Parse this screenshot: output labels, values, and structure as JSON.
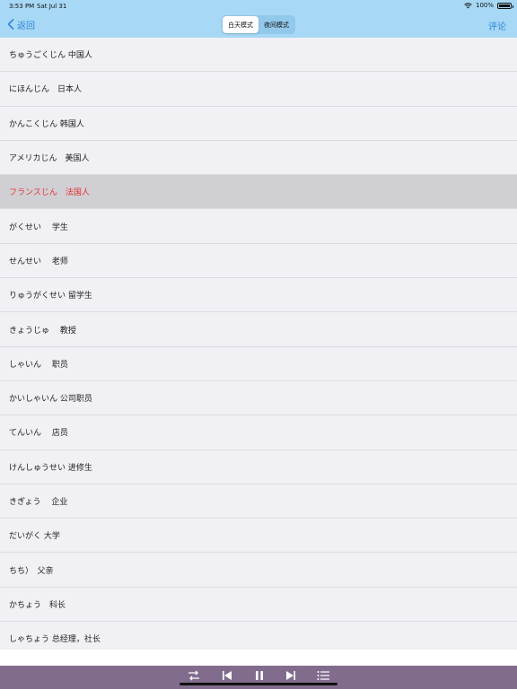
{
  "status_bar": {
    "time": "3:53 PM",
    "date": "Sat Jul 31",
    "battery": "100%",
    "battery_level": 1.0
  },
  "nav": {
    "back_label": "返回",
    "mode_day": "白天模式",
    "mode_night": "夜间模式",
    "active_mode": "day",
    "comment_label": "评论"
  },
  "list": {
    "selected_index": 4,
    "items": [
      {
        "text": "ちゅうごくじん 中国人"
      },
      {
        "text": "にほんじん　日本人"
      },
      {
        "text": "かんこくじん 韩国人"
      },
      {
        "text": "アメリカじん　美国人"
      },
      {
        "text": "フランスじん　法国人"
      },
      {
        "text": "がくせい　 学生"
      },
      {
        "text": "せんせい　 老师"
      },
      {
        "text": "りゅうがくせい 留学生"
      },
      {
        "text": "きょうじゅ　 教授"
      },
      {
        "text": "しゃいん　 职员"
      },
      {
        "text": "かいしゃいん 公司职员"
      },
      {
        "text": "てんいん　 店员"
      },
      {
        "text": "けんしゅうせい 进修生"
      },
      {
        "text": "きぎょう　 企业"
      },
      {
        "text": "だいがく 大学"
      },
      {
        "text": "ちち）　父亲"
      },
      {
        "text": "かちょう　科长"
      },
      {
        "text": "しゃちょう 总经理，社长"
      }
    ]
  },
  "player": {
    "icons": [
      "repeat-icon",
      "previous-icon",
      "pause-icon",
      "next-icon",
      "playlist-icon"
    ]
  },
  "colors": {
    "nav_bg": "#a7d8f6",
    "accent": "#2f87d6",
    "selected_text": "#e6302a",
    "selected_bg": "#d0cfd4",
    "player_bg": "#826c8e"
  }
}
